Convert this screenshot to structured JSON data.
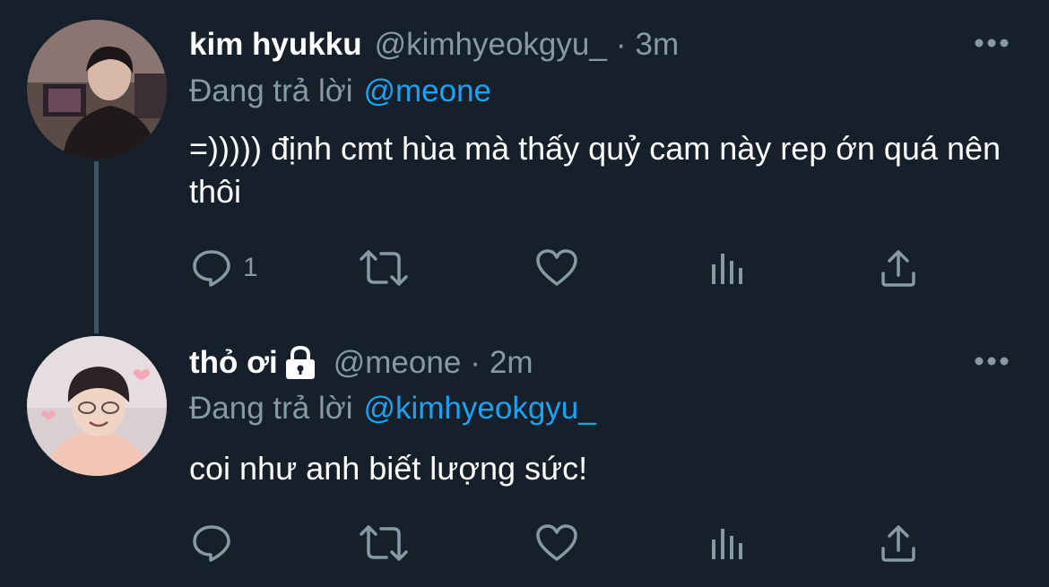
{
  "colors": {
    "background": "#15202b",
    "text_primary": "#ffffff",
    "text_secondary": "#8899a6",
    "link": "#1da1f2",
    "thread_line": "#3d5466"
  },
  "tweets": [
    {
      "display_name": "kim hyukku",
      "handle": "@kimhyeokgyu_",
      "separator": "·",
      "time": "3m",
      "reply_prefix": "Đang trả lời",
      "reply_to": "@meone",
      "text": "=))))) định cmt hùa mà thấy quỷ cam này rep ớn quá nên thôi",
      "reply_count": "1",
      "locked": false,
      "avatar_icon": "user-photo"
    },
    {
      "display_name": "thỏ ơi",
      "handle": "@meone",
      "separator": "·",
      "time": "2m",
      "reply_prefix": "Đang trả lời",
      "reply_to": "@kimhyeokgyu_",
      "text": "coi như anh biết lượng sức!",
      "reply_count": "",
      "locked": true,
      "avatar_icon": "user-photo"
    }
  ],
  "icons": {
    "reply": "reply-icon",
    "retweet": "retweet-icon",
    "like": "heart-icon",
    "stats": "analytics-icon",
    "share": "share-icon",
    "more": "more-icon",
    "lock": "lock-icon"
  }
}
